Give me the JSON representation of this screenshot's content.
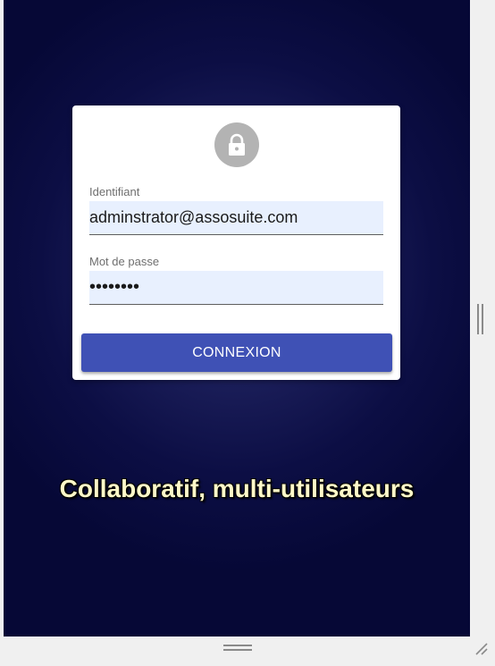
{
  "login": {
    "lock_icon": "lock-icon",
    "username_label": "Identifiant",
    "username_value": "adminstrator@assosuite.com",
    "password_label": "Mot de passe",
    "password_value": "••••••••",
    "submit_label": "CONNEXION"
  },
  "tagline": "Collaboratif, multi-utilisateurs",
  "colors": {
    "background_center": "#2c3070",
    "background_edge": "#060836",
    "button": "#3f51b5",
    "field_fill": "#e8f0fe",
    "tagline": "#fff9c9"
  }
}
